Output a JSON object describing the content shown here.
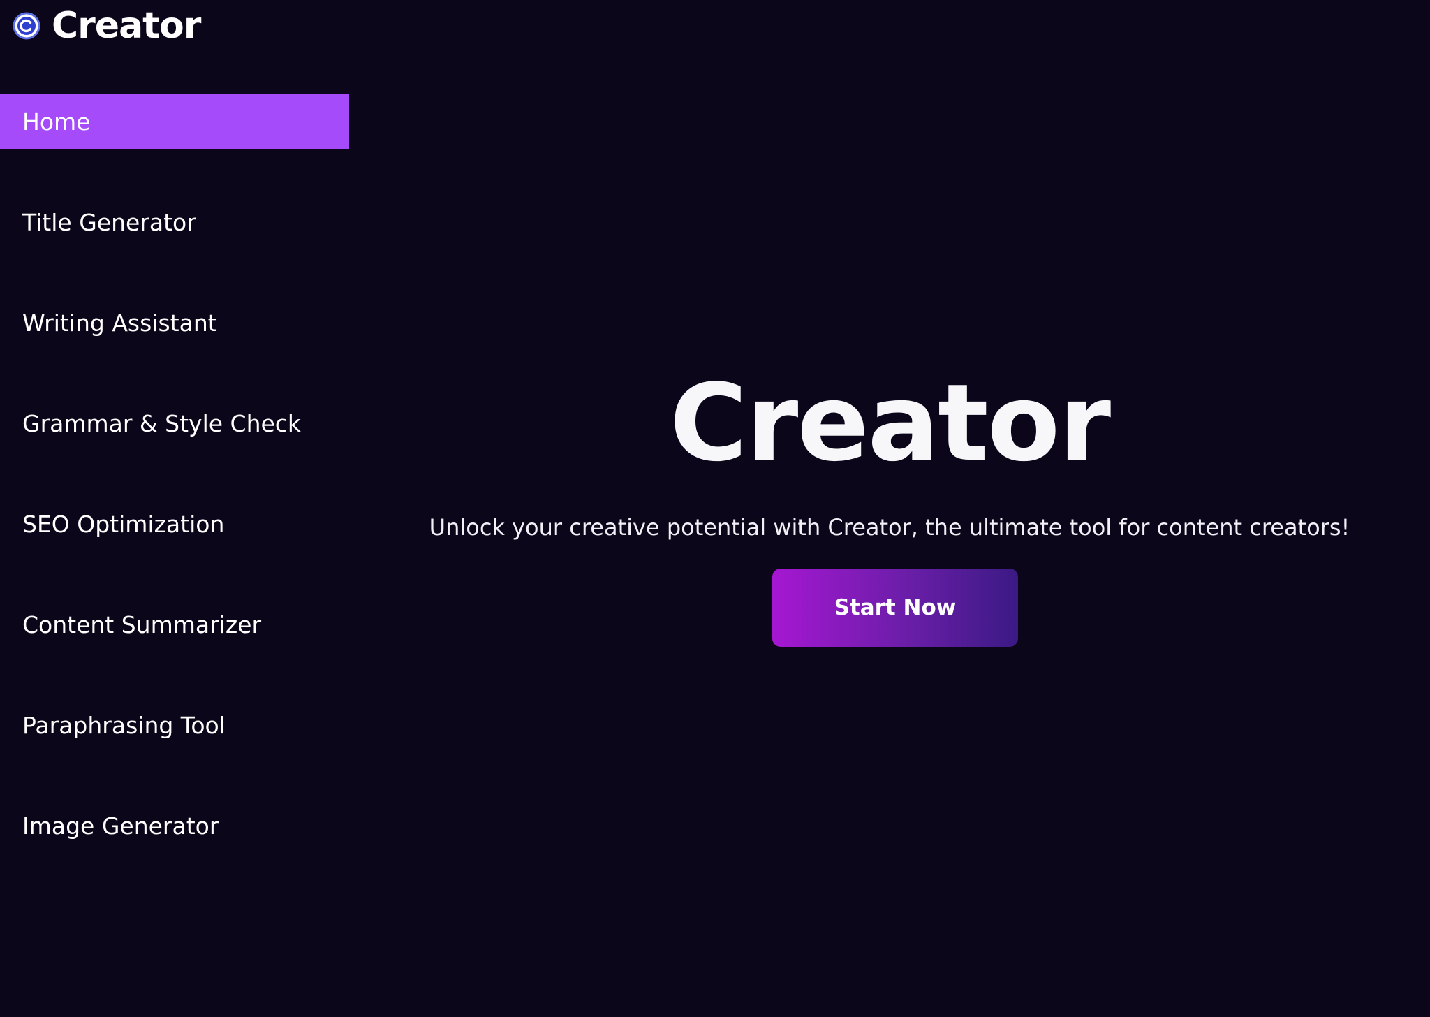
{
  "app": {
    "brand_name": "Creator",
    "brand_icon": "copyright-c-icon"
  },
  "sidebar": {
    "items": [
      {
        "label": "Home",
        "active": true
      },
      {
        "label": "Title Generator",
        "active": false
      },
      {
        "label": "Writing Assistant",
        "active": false
      },
      {
        "label": "Grammar & Style Check",
        "active": false
      },
      {
        "label": "SEO Optimization",
        "active": false
      },
      {
        "label": "Content Summarizer",
        "active": false
      },
      {
        "label": "Paraphrasing Tool",
        "active": false
      },
      {
        "label": "Image Generator",
        "active": false
      }
    ]
  },
  "hero": {
    "title": "Creator",
    "subtitle": "Unlock your creative potential with Creator, the ultimate tool for content creators!",
    "cta_label": "Start Now"
  },
  "colors": {
    "background": "#0b0619",
    "active_nav": "#a64bf9",
    "cta_gradient_start": "#a617d2",
    "cta_gradient_end": "#3b1a84",
    "brand_icon": "#5b6ee8"
  }
}
